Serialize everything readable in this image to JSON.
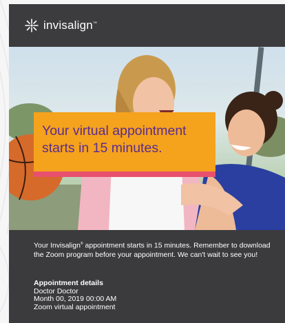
{
  "brand": {
    "name": "invisalign",
    "trademark": "™"
  },
  "hero": {
    "headline": "Your virtual appointment starts in 15 minutes."
  },
  "message": {
    "part1": "Your Invisalign",
    "trademark": "®",
    "part2": " appointment starts in 15 minutes. Remember to download the Zoom program before your appointment. We can't wait to see you!"
  },
  "details": {
    "heading": "Appointment details",
    "doctor": "Doctor Doctor",
    "datetime": "Month 00, 2019 00:00 AM",
    "location": "Zoom virtual appointment"
  },
  "colors": {
    "header_bg": "#3c3c3f",
    "banner_bg": "#f5a21c",
    "banner_text": "#5a2d8f",
    "banner_stripe": "#e8506e"
  },
  "icons": {
    "logo": "invisalign-star-logo-icon"
  }
}
